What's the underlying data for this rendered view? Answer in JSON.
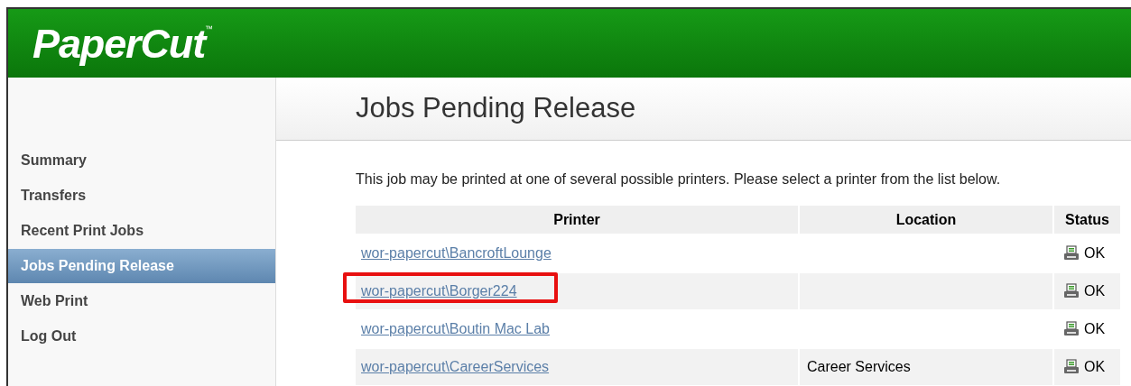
{
  "header": {
    "logo": "PaperCut",
    "trademark": "™"
  },
  "sidebar": {
    "items": [
      {
        "label": "Summary",
        "selected": false
      },
      {
        "label": "Transfers",
        "selected": false
      },
      {
        "label": "Recent Print Jobs",
        "selected": false
      },
      {
        "label": "Jobs Pending Release",
        "selected": true
      },
      {
        "label": "Web Print",
        "selected": false
      },
      {
        "label": "Log Out",
        "selected": false
      }
    ]
  },
  "page": {
    "title": "Jobs Pending Release",
    "intro": "This job may be printed at one of several possible printers. Please select a printer from the list below."
  },
  "table": {
    "columns": [
      "Printer",
      "Location",
      "Status"
    ],
    "rows": [
      {
        "printer": "wor-papercut\\BancroftLounge",
        "location": "",
        "status": "OK",
        "highlighted": false
      },
      {
        "printer": "wor-papercut\\Borger224",
        "location": "",
        "status": "OK",
        "highlighted": true
      },
      {
        "printer": "wor-papercut\\Boutin Mac Lab",
        "location": "",
        "status": "OK",
        "highlighted": false
      },
      {
        "printer": "wor-papercut\\CareerServices",
        "location": "Career Services",
        "status": "OK",
        "highlighted": false
      }
    ]
  }
}
